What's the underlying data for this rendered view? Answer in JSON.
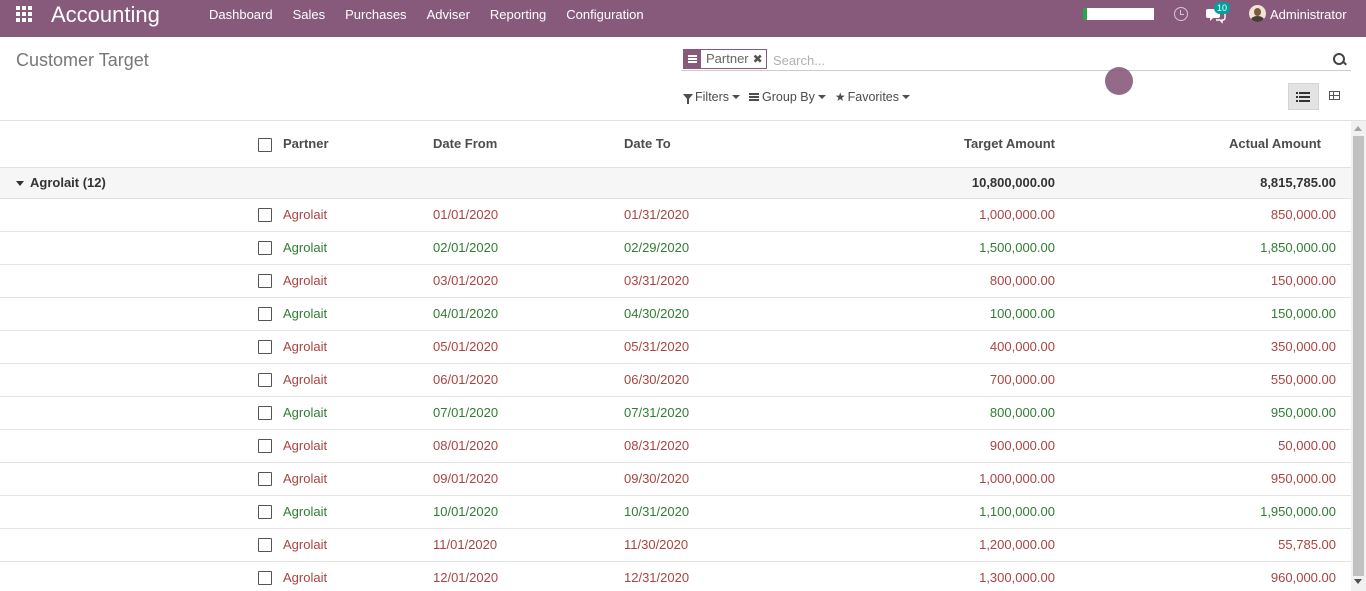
{
  "topbar": {
    "app_title": "Accounting",
    "menu": [
      "Dashboard",
      "Sales",
      "Purchases",
      "Adviser",
      "Reporting",
      "Configuration"
    ],
    "progress_fraction": 0.06,
    "progress_color": "#28a745",
    "notification_count": "10",
    "user_name": "Administrator",
    "bar_color": "#875a7b"
  },
  "control": {
    "page_title": "Customer Target",
    "facet_label": "Partner",
    "facet_remove": "✖",
    "search_placeholder": "Search...",
    "filters_label": "Filters",
    "groupby_label": "Group By",
    "favorites_label": "Favorites"
  },
  "table": {
    "columns": {
      "partner": "Partner",
      "date_from": "Date From",
      "date_to": "Date To",
      "target_amount": "Target Amount",
      "actual_amount": "Actual Amount"
    },
    "group": {
      "label": "Agrolait (12)",
      "target_total": "10,800,000.00",
      "actual_total": "8,815,785.00"
    },
    "rows": [
      {
        "partner": "Agrolait",
        "date_from": "01/01/2020",
        "date_to": "01/31/2020",
        "target": "1,000,000.00",
        "actual": "850,000.00",
        "status": "red"
      },
      {
        "partner": "Agrolait",
        "date_from": "02/01/2020",
        "date_to": "02/29/2020",
        "target": "1,500,000.00",
        "actual": "1,850,000.00",
        "status": "green"
      },
      {
        "partner": "Agrolait",
        "date_from": "03/01/2020",
        "date_to": "03/31/2020",
        "target": "800,000.00",
        "actual": "150,000.00",
        "status": "red"
      },
      {
        "partner": "Agrolait",
        "date_from": "04/01/2020",
        "date_to": "04/30/2020",
        "target": "100,000.00",
        "actual": "150,000.00",
        "status": "green"
      },
      {
        "partner": "Agrolait",
        "date_from": "05/01/2020",
        "date_to": "05/31/2020",
        "target": "400,000.00",
        "actual": "350,000.00",
        "status": "red"
      },
      {
        "partner": "Agrolait",
        "date_from": "06/01/2020",
        "date_to": "06/30/2020",
        "target": "700,000.00",
        "actual": "550,000.00",
        "status": "red"
      },
      {
        "partner": "Agrolait",
        "date_from": "07/01/2020",
        "date_to": "07/31/2020",
        "target": "800,000.00",
        "actual": "950,000.00",
        "status": "green"
      },
      {
        "partner": "Agrolait",
        "date_from": "08/01/2020",
        "date_to": "08/31/2020",
        "target": "900,000.00",
        "actual": "50,000.00",
        "status": "red"
      },
      {
        "partner": "Agrolait",
        "date_from": "09/01/2020",
        "date_to": "09/30/2020",
        "target": "1,000,000.00",
        "actual": "950,000.00",
        "status": "red"
      },
      {
        "partner": "Agrolait",
        "date_from": "10/01/2020",
        "date_to": "10/31/2020",
        "target": "1,100,000.00",
        "actual": "1,950,000.00",
        "status": "green"
      },
      {
        "partner": "Agrolait",
        "date_from": "11/01/2020",
        "date_to": "11/30/2020",
        "target": "1,200,000.00",
        "actual": "55,785.00",
        "status": "red"
      },
      {
        "partner": "Agrolait",
        "date_from": "12/01/2020",
        "date_to": "12/31/2020",
        "target": "1,300,000.00",
        "actual": "960,000.00",
        "status": "red"
      }
    ]
  }
}
